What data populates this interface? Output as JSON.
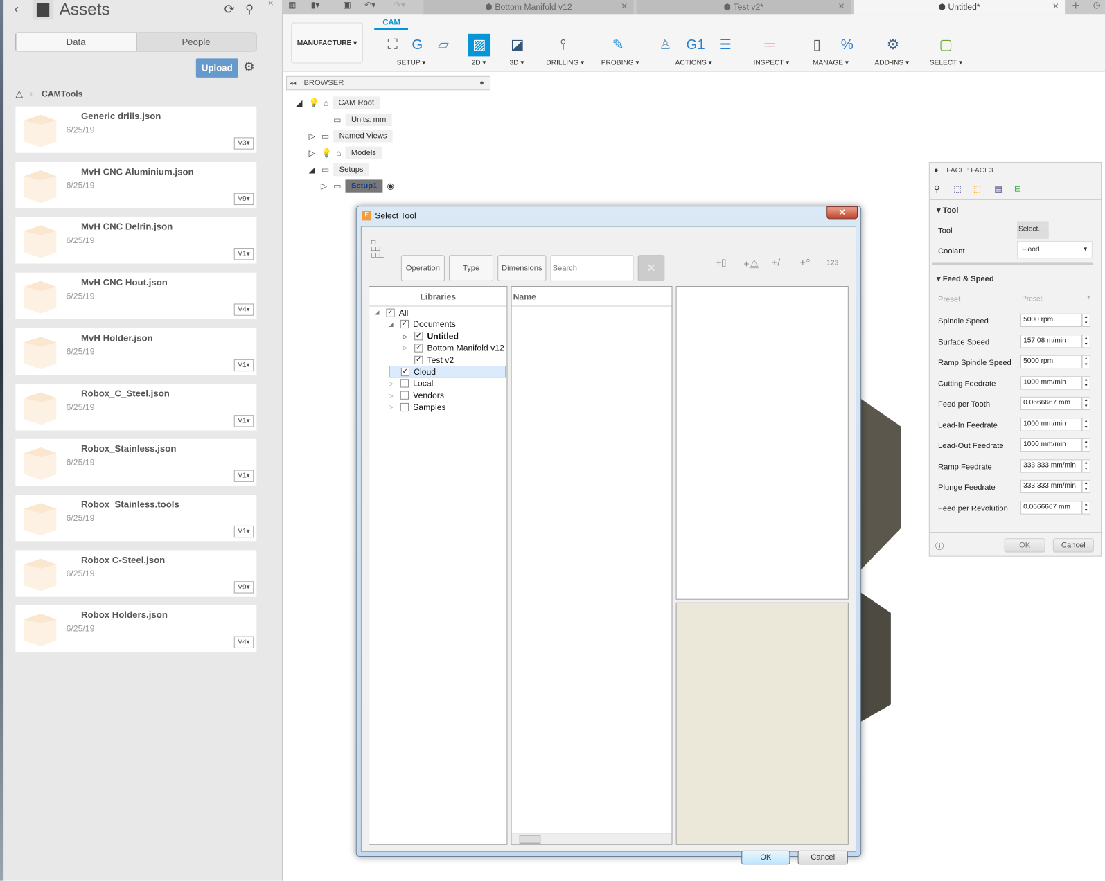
{
  "assets": {
    "title": "Assets",
    "tabs": [
      "Data",
      "People"
    ],
    "upload": "Upload",
    "breadcrumb": "CAMTools",
    "items": [
      {
        "name": "Generic drills.json",
        "date": "6/25/19",
        "version": "V3"
      },
      {
        "name": "MvH CNC Aluminium.json",
        "date": "6/25/19",
        "version": "V9"
      },
      {
        "name": "MvH CNC Delrin.json",
        "date": "6/25/19",
        "version": "V1"
      },
      {
        "name": "MvH CNC Hout.json",
        "date": "6/25/19",
        "version": "V4"
      },
      {
        "name": "MvH Holder.json",
        "date": "6/25/19",
        "version": "V1"
      },
      {
        "name": "Robox_C_Steel.json",
        "date": "6/25/19",
        "version": "V1"
      },
      {
        "name": "Robox_Stainless.json",
        "date": "6/25/19",
        "version": "V1"
      },
      {
        "name": "Robox_Stainless.tools",
        "date": "6/25/19",
        "version": "V1"
      },
      {
        "name": "Robox C-Steel.json",
        "date": "6/25/19",
        "version": "V9"
      },
      {
        "name": "Robox Holders.json",
        "date": "6/25/19",
        "version": "V4"
      }
    ]
  },
  "doc_tabs": [
    "Bottom Manifold v12",
    "Test v2*",
    "Untitled*"
  ],
  "ribbon": {
    "workspace": "MANUFACTURE",
    "tab": "CAM",
    "groups": [
      "SETUP",
      "2D",
      "3D",
      "DRILLING",
      "PROBING",
      "ACTIONS",
      "INSPECT",
      "MANAGE",
      "ADD-INS",
      "SELECT"
    ],
    "accent": "#0696d7"
  },
  "browser": {
    "title": "BROWSER",
    "nodes": [
      "CAM Root",
      "Units: mm",
      "Named Views",
      "Models",
      "Setups",
      "Setup1"
    ]
  },
  "dialog": {
    "title": "Select Tool",
    "filters": [
      "Operation",
      "Type",
      "Dimensions"
    ],
    "search_placeholder": "Search",
    "libraries_header": "Libraries",
    "name_header": "Name",
    "tree": [
      {
        "label": "All",
        "checked": true
      },
      {
        "label": "Documents",
        "checked": true
      },
      {
        "label": "Untitled",
        "checked": true
      },
      {
        "label": "Bottom Manifold v12",
        "checked": true
      },
      {
        "label": "Test v2",
        "checked": true
      },
      {
        "label": "Cloud",
        "checked": true,
        "selected": true
      },
      {
        "label": "Local",
        "checked": false
      },
      {
        "label": "Vendors",
        "checked": false
      },
      {
        "label": "Samples",
        "checked": false
      }
    ],
    "ok": "OK",
    "cancel": "Cancel",
    "number_icon": "123"
  },
  "props": {
    "title": "FACE : FACE3",
    "tool_section": "Tool",
    "tool_label": "Tool",
    "tool_button": "Select...",
    "coolant_label": "Coolant",
    "coolant_value": "Flood",
    "feed_section": "Feed & Speed",
    "preset_label": "Preset",
    "preset_value": "Preset",
    "fields": [
      {
        "label": "Spindle Speed",
        "value": "5000 rpm"
      },
      {
        "label": "Surface Speed",
        "value": "157.08 m/min"
      },
      {
        "label": "Ramp Spindle Speed",
        "value": "5000 rpm"
      },
      {
        "label": "Cutting Feedrate",
        "value": "1000 mm/min"
      },
      {
        "label": "Feed per Tooth",
        "value": "0.0666667 mm"
      },
      {
        "label": "Lead-In Feedrate",
        "value": "1000 mm/min"
      },
      {
        "label": "Lead-Out Feedrate",
        "value": "1000 mm/min"
      },
      {
        "label": "Ramp Feedrate",
        "value": "333.333 mm/min"
      },
      {
        "label": "Plunge Feedrate",
        "value": "333.333 mm/min"
      },
      {
        "label": "Feed per Revolution",
        "value": "0.0666667 mm"
      }
    ],
    "ok": "OK",
    "cancel": "Cancel"
  }
}
